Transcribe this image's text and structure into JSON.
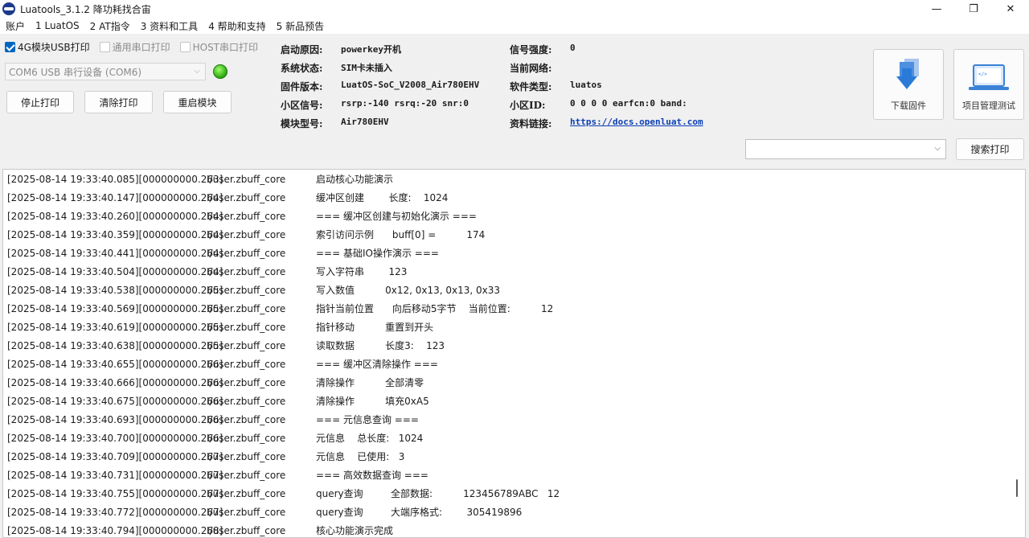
{
  "window": {
    "title": "Luatools_3.1.2 降功耗找合宙",
    "controls": {
      "minimize": "—",
      "maximize": "❐",
      "close": "✕"
    }
  },
  "menu": [
    "账户",
    "1 LuatOS",
    "2 AT指令",
    "3 资料和工具",
    "4 帮助和支持",
    "5 新品预告"
  ],
  "options": {
    "usb_4g": {
      "label": "4G模块USB打印",
      "checked": true
    },
    "serial": {
      "label": "通用串口打印",
      "checked": false
    },
    "host": {
      "label": "HOST串口打印",
      "checked": false
    }
  },
  "port": {
    "value": "COM6 USB 串行设备 (COM6)"
  },
  "status_led": {
    "color": "#2aa50f"
  },
  "buttons": {
    "stop": "停止打印",
    "clear": "清除打印",
    "restart": "重启模块",
    "download": "下载固件",
    "project": "项目管理测试",
    "search": "搜索打印"
  },
  "info_left": [
    {
      "key": "启动原因:",
      "value": "powerkey开机"
    },
    {
      "key": "系统状态:",
      "value": "SIM卡未插入"
    },
    {
      "key": "固件版本:",
      "value": "LuatOS-SoC_V2008_Air780EHV"
    },
    {
      "key": "小区信号:",
      "value": "rsrp:-140 rsrq:-20 snr:0"
    },
    {
      "key": "模块型号:",
      "value": "Air780EHV"
    }
  ],
  "info_right": [
    {
      "key": "信号强度:",
      "value": "0"
    },
    {
      "key": "当前网络:",
      "value": ""
    },
    {
      "key": "软件类型:",
      "value": "luatos"
    },
    {
      "key": "小区ID:",
      "value": "0 0 0 0 earfcn:0 band:"
    },
    {
      "key": "资料链接:",
      "value": "https://docs.openluat.com"
    }
  ],
  "search": {
    "value": ""
  },
  "log": [
    {
      "ts": "[2025-08-14 19:33:40.085][000000000.263]",
      "tag": "I/user.zbuff_core",
      "msg": "启动核心功能演示"
    },
    {
      "ts": "[2025-08-14 19:33:40.147][000000000.264]",
      "tag": "I/user.zbuff_core",
      "msg": "缓冲区创建        长度:    1024"
    },
    {
      "ts": "[2025-08-14 19:33:40.260][000000000.264]",
      "tag": "I/user.zbuff_core",
      "msg": "=== 缓冲区创建与初始化演示 ==="
    },
    {
      "ts": "[2025-08-14 19:33:40.359][000000000.264]",
      "tag": "I/user.zbuff_core",
      "msg": "索引访问示例      buff[0] =          174"
    },
    {
      "ts": "[2025-08-14 19:33:40.441][000000000.264]",
      "tag": "I/user.zbuff_core",
      "msg": "=== 基础IO操作演示 ==="
    },
    {
      "ts": "[2025-08-14 19:33:40.504][000000000.264]",
      "tag": "I/user.zbuff_core",
      "msg": "写入字符串        123"
    },
    {
      "ts": "[2025-08-14 19:33:40.538][000000000.265]",
      "tag": "I/user.zbuff_core",
      "msg": "写入数值          0x12, 0x13, 0x13, 0x33"
    },
    {
      "ts": "[2025-08-14 19:33:40.569][000000000.265]",
      "tag": "I/user.zbuff_core",
      "msg": "指针当前位置      向后移动5字节    当前位置:          12"
    },
    {
      "ts": "[2025-08-14 19:33:40.619][000000000.265]",
      "tag": "I/user.zbuff_core",
      "msg": "指针移动          重置到开头"
    },
    {
      "ts": "[2025-08-14 19:33:40.638][000000000.265]",
      "tag": "I/user.zbuff_core",
      "msg": "读取数据          长度3:    123"
    },
    {
      "ts": "[2025-08-14 19:33:40.655][000000000.266]",
      "tag": "I/user.zbuff_core",
      "msg": "=== 缓冲区清除操作 ==="
    },
    {
      "ts": "[2025-08-14 19:33:40.666][000000000.266]",
      "tag": "I/user.zbuff_core",
      "msg": "清除操作          全部清零"
    },
    {
      "ts": "[2025-08-14 19:33:40.675][000000000.266]",
      "tag": "I/user.zbuff_core",
      "msg": "清除操作          填充0xA5"
    },
    {
      "ts": "[2025-08-14 19:33:40.693][000000000.266]",
      "tag": "I/user.zbuff_core",
      "msg": "=== 元信息查询 ==="
    },
    {
      "ts": "[2025-08-14 19:33:40.700][000000000.266]",
      "tag": "I/user.zbuff_core",
      "msg": "元信息    总长度:   1024"
    },
    {
      "ts": "[2025-08-14 19:33:40.709][000000000.267]",
      "tag": "I/user.zbuff_core",
      "msg": "元信息    已使用:   3"
    },
    {
      "ts": "[2025-08-14 19:33:40.731][000000000.267]",
      "tag": "I/user.zbuff_core",
      "msg": "=== 高效数据查询 ==="
    },
    {
      "ts": "[2025-08-14 19:33:40.755][000000000.267]",
      "tag": "I/user.zbuff_core",
      "msg": "query查询         全部数据:          123456789ABC   12"
    },
    {
      "ts": "[2025-08-14 19:33:40.772][000000000.267]",
      "tag": "I/user.zbuff_core",
      "msg": "query查询         大端序格式:        305419896"
    },
    {
      "ts": "[2025-08-14 19:33:40.794][000000000.268]",
      "tag": "I/user.zbuff_core",
      "msg": "核心功能演示完成"
    }
  ]
}
